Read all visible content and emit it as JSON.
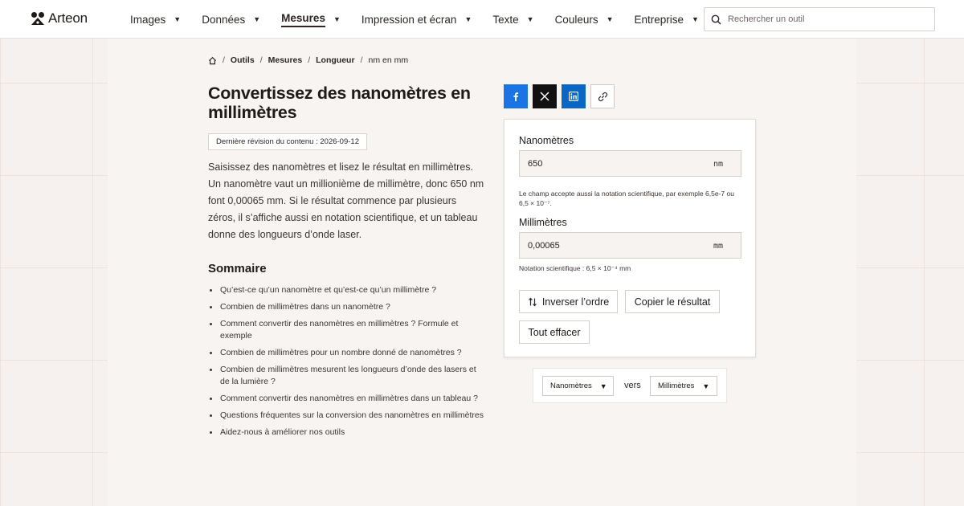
{
  "app": {
    "brand": "Arteon"
  },
  "nav": {
    "items": [
      {
        "label": "Images"
      },
      {
        "label": "Données"
      },
      {
        "label": "Mesures"
      },
      {
        "label": "Impression et écran"
      },
      {
        "label": "Texte"
      },
      {
        "label": "Couleurs"
      },
      {
        "label": "Entreprise"
      }
    ],
    "active": "Mesures"
  },
  "search": {
    "placeholder": "Rechercher un outil"
  },
  "breadcrumb": {
    "items": [
      "Outils",
      "Mesures",
      "Longueur"
    ],
    "current": "nm en mm"
  },
  "page": {
    "title": "Convertissez des nanomètres en millimètres",
    "revision": "Dernière révision du contenu : 2026-09-12",
    "intro": "Saisissez des nanomètres et lisez le résultat en millimètres. Un nanomètre vaut un millionième de millimètre, donc 650 nm font 0,00065 mm. Si le résultat commence par plusieurs zéros, il s’affiche aussi en notation scientifique, et un tableau donne des longueurs d’onde laser."
  },
  "summary": {
    "title": "Sommaire",
    "items": [
      "Qu’est-ce qu’un nanomètre et qu’est-ce qu’un millimètre ?",
      "Combien de millimètres dans un nanomètre ?",
      "Comment convertir des nanomètres en millimètres ? Formule et exemple",
      "Combien de millimètres pour un nombre donné de nanomètres ?",
      "Combien de millimètres mesurent les longueurs d’onde des lasers et de la lumière ?",
      "Comment convertir des nanomètres en millimètres dans un tableau ?",
      "Questions fréquentes sur la conversion des nanomètres en millimètres",
      "Aidez-nous à améliorer nos outils"
    ]
  },
  "share": {
    "icons": [
      "facebook-icon",
      "x-icon",
      "linkedin-icon",
      "link-icon"
    ]
  },
  "converter": {
    "input_label": "Nanomètres",
    "input_value": "650",
    "input_unit": "nm",
    "input_hint": "Le champ accepte aussi la notation scientifique, par exemple 6,5e-7 ou 6,5 × 10⁻⁷.",
    "output_label": "Millimètres",
    "output_value": "0,00065",
    "output_unit": "mm",
    "output_hint": "Notation scientifique : 6,5 × 10⁻⁴ mm",
    "swap_label": "Inverser l’ordre",
    "copy_label": "Copier le résultat",
    "clear_label": "Tout effacer"
  },
  "unit_selector": {
    "from": "Nanomètres",
    "connector": "vers",
    "to": "Millimètres"
  },
  "colors": {
    "facebook": "#1a74e4",
    "x": "#111111",
    "linkedin": "#0a66c2",
    "background": "#f6f1ee"
  }
}
